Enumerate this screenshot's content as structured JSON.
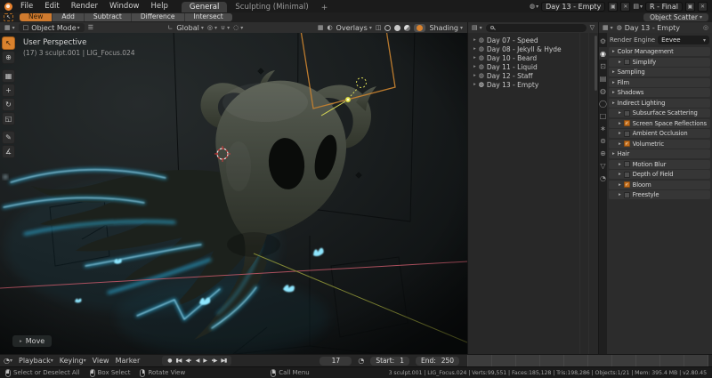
{
  "topbar": {
    "menus": [
      "File",
      "Edit",
      "Render",
      "Window",
      "Help"
    ],
    "tabs": [
      {
        "label": "General"
      },
      {
        "label": "Sculpting (Minimal)"
      }
    ],
    "new_tab": "+",
    "scene": "Day 13 - Empty",
    "view_layer": "R - Final"
  },
  "tool_settings": {
    "buttons": [
      {
        "label": "New"
      },
      {
        "label": "Add"
      },
      {
        "label": "Subtract"
      },
      {
        "label": "Difference"
      },
      {
        "label": "Intersect"
      }
    ],
    "object_scatter": "Object Scatter"
  },
  "viewport_header": {
    "mode": "Object Mode",
    "orientation": "Global",
    "overlays": "Overlays",
    "shading": "Shading"
  },
  "viewport": {
    "view_name": "User Perspective",
    "context_line": "(17) 3 sculpt.001 | LIG_Focus.024",
    "operator_panel": "Move"
  },
  "outliner": {
    "items": [
      {
        "label": "Day 07 - Speed"
      },
      {
        "label": "Day 08 - Jekyll & Hyde"
      },
      {
        "label": "Day 10 - Beard"
      },
      {
        "label": "Day 11 - Liquid"
      },
      {
        "label": "Day 12 - Staff"
      },
      {
        "label": "Day 13 - Empty"
      }
    ]
  },
  "properties": {
    "breadcrumb": "Day 13 - Empty",
    "render_engine_label": "Render Engine",
    "render_engine": "Eevee",
    "panels": [
      {
        "label": "Color Management",
        "checkbox": "none"
      },
      {
        "label": "Simplify",
        "checkbox": "unchecked"
      },
      {
        "label": "Sampling",
        "checkbox": "none"
      },
      {
        "label": "Film",
        "checkbox": "none"
      },
      {
        "label": "Shadows",
        "checkbox": "none"
      },
      {
        "label": "Indirect Lighting",
        "checkbox": "none"
      },
      {
        "label": "Subsurface Scattering",
        "checkbox": "unchecked"
      },
      {
        "label": "Screen Space Reflections",
        "checkbox": "checked"
      },
      {
        "label": "Ambient Occlusion",
        "checkbox": "unchecked"
      },
      {
        "label": "Volumetric",
        "checkbox": "checked"
      },
      {
        "label": "Hair",
        "checkbox": "none"
      },
      {
        "label": "Motion Blur",
        "checkbox": "unchecked"
      },
      {
        "label": "Depth of Field",
        "checkbox": "unchecked"
      },
      {
        "label": "Bloom",
        "checkbox": "checked"
      },
      {
        "label": "Freestyle",
        "checkbox": "unchecked"
      }
    ]
  },
  "timeline": {
    "menus": [
      "Playback",
      "Keying",
      "View",
      "Marker"
    ],
    "frame": "17",
    "start_label": "Start:",
    "start": "1",
    "end_label": "End:",
    "end": "250"
  },
  "statusbar": {
    "hints": [
      "Select or Deselect All",
      "Box Select",
      "Rotate View",
      "Call Menu"
    ],
    "stats": "3 sculpt.001 | LIG_Focus.024 | Verts:99,551 | Faces:185,128 | Tris:198,286 | Objects:1/21 | Mem: 395.4 MB | v2.80.45"
  },
  "colors": {
    "accent": "#d9822e",
    "glow": "#3ec9f2",
    "select_orange": "#cf7a2e"
  },
  "icons": {
    "dropdown": "▾",
    "collapsed": "▸",
    "hamburger": "☰",
    "close": "✕",
    "duplicate": "▣",
    "scene": "◍",
    "view_layer": "▤",
    "funnel": "▽",
    "pin": "◎",
    "editor_3d": "▦",
    "editor_outliner": "▤",
    "editor_props": "▦",
    "editor_timeline": "◔",
    "mode_object": "□",
    "orientation": "∟",
    "pivot": "◎",
    "magnet": "∪",
    "proportional": "◌",
    "gizmo": "▦",
    "overlays_glyph": "◐",
    "xray": "◫",
    "active_tool": "↖",
    "tools": [
      "↖",
      "⊕",
      "▦",
      "+",
      "↻",
      "◱",
      "✎",
      "∡"
    ],
    "playback": [
      "●",
      "▮◀",
      "◀∙",
      "◀",
      "▶",
      "∙▶",
      "▶▮"
    ],
    "props_tabs": [
      {
        "name": "tool",
        "glyph": "⚙"
      },
      {
        "name": "render",
        "glyph": "◉"
      },
      {
        "name": "output",
        "glyph": "⊡"
      },
      {
        "name": "view-layer",
        "glyph": "▤"
      },
      {
        "name": "scene",
        "glyph": "◍"
      },
      {
        "name": "world",
        "glyph": "◯"
      },
      {
        "name": "object",
        "glyph": "□"
      },
      {
        "name": "modifiers",
        "glyph": "∗"
      },
      {
        "name": "particles",
        "glyph": "⊚"
      },
      {
        "name": "physics",
        "glyph": "⊕"
      },
      {
        "name": "object-data",
        "glyph": "▽"
      },
      {
        "name": "material",
        "glyph": "◔"
      }
    ]
  }
}
